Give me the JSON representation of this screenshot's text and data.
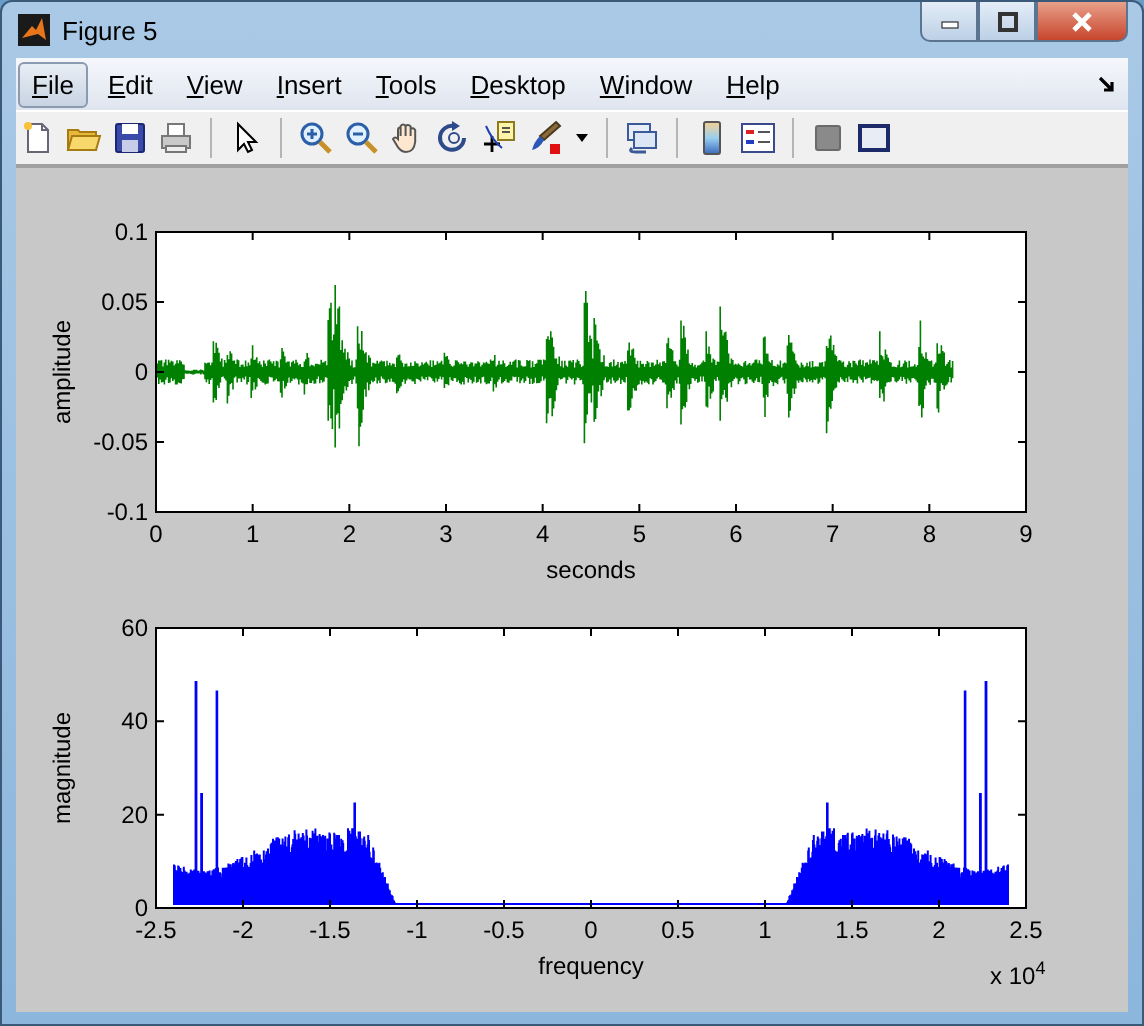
{
  "window": {
    "title": "Figure 5"
  },
  "menu": [
    {
      "label": "File",
      "selected": true
    },
    {
      "label": "Edit",
      "selected": false
    },
    {
      "label": "View",
      "selected": false
    },
    {
      "label": "Insert",
      "selected": false
    },
    {
      "label": "Tools",
      "selected": false
    },
    {
      "label": "Desktop",
      "selected": false
    },
    {
      "label": "Window",
      "selected": false
    },
    {
      "label": "Help",
      "selected": false
    }
  ],
  "plots": [
    {
      "kind": "waveform",
      "ylabel": "amplitude",
      "xlabel": "seconds",
      "yticks": [
        "0.1",
        "0.05",
        "0",
        "-0.05",
        "-0.1"
      ],
      "xticks": [
        "0",
        "1",
        "2",
        "3",
        "4",
        "5",
        "6",
        "7",
        "8",
        "9"
      ]
    },
    {
      "kind": "spectrum",
      "ylabel": "magnitude",
      "xlabel": "frequency",
      "yticks": [
        "60",
        "40",
        "20",
        "0"
      ],
      "xticks": [
        "-2.5",
        "-2",
        "-1.5",
        "-1",
        "-0.5",
        "0",
        "0.5",
        "1",
        "1.5",
        "2",
        "2.5"
      ],
      "x_multiplier": "x 10$^{4}$"
    }
  ]
}
